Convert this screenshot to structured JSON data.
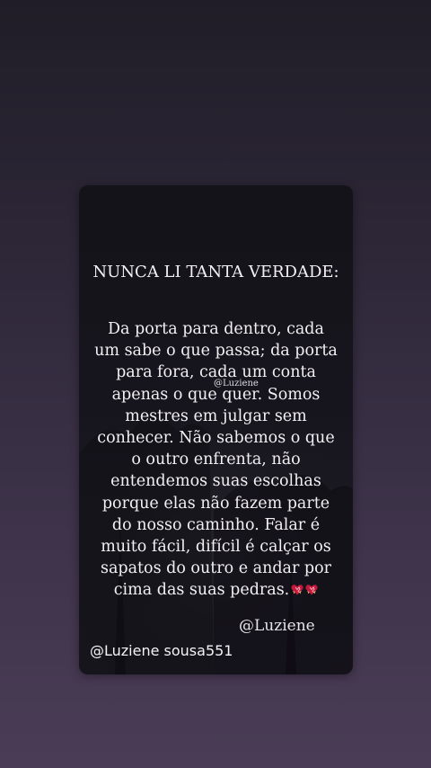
{
  "quote": {
    "title": "NUNCA LI TANTA VERDADE:",
    "body": "Da porta para dentro, cada um sabe o que passa; da porta para fora, cada um conta apenas o que quer. Somos mestres em julgar sem conhecer. Não sabemos o que o outro enfrenta, não entendemos suas escolhas porque elas não fazem parte do nosso caminho. Falar é muito fácil, difícil é calçar os sapatos do outro e andar por cima das suas pedras.",
    "heart_icons": [
      "heart-icon",
      "heart-icon"
    ],
    "watermark": "@Luziene",
    "signature": "@Luziene"
  },
  "story": {
    "user_handle": "@Luziene sousa551"
  },
  "colors": {
    "background_top": "#201d27",
    "background_bottom": "#4a3c56",
    "card": "#16141c",
    "text": "#f2f0f3",
    "heart": "#c4183c"
  }
}
